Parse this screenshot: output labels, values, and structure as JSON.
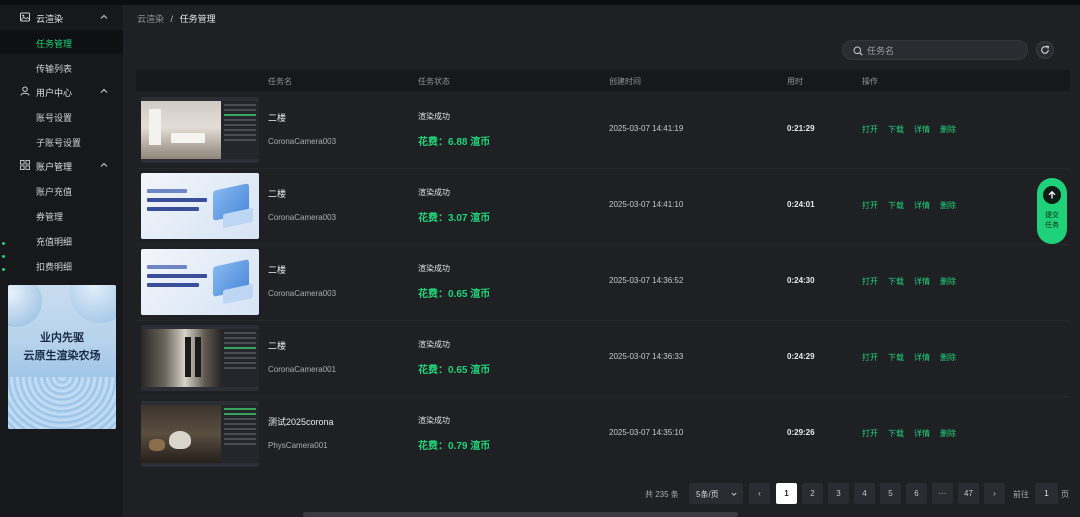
{
  "sidebar": {
    "groups": [
      {
        "label": "云渲染",
        "icon": "image-icon"
      },
      {
        "label": "用户中心",
        "icon": "user-icon"
      },
      {
        "label": "账户管理",
        "icon": "grid-icon"
      }
    ],
    "items": {
      "task_manage": "任务管理",
      "transfer_list": "传输列表",
      "account_settings": "账号设置",
      "sub_account_settings": "子账号设置",
      "account_recharge": "账户充值",
      "voucher_manage": "券管理",
      "recharge_detail": "充值明细",
      "deduct_detail": "扣费明细"
    },
    "promo": {
      "line1": "业内先驱",
      "line2": "云原生渲染农场"
    }
  },
  "breadcrumb": {
    "root": "云渲染",
    "sep": "/",
    "current": "任务管理"
  },
  "search": {
    "placeholder": "任务名"
  },
  "table": {
    "headers": {
      "name": "任务名",
      "status": "任务状态",
      "created": "创建时间",
      "duration": "用时",
      "ops": "操作"
    },
    "actions": {
      "open": "打开",
      "download": "下载",
      "detail": "详情",
      "delete": "删除"
    },
    "rows": [
      {
        "name": "二楼",
        "camera": "CoronaCamera003",
        "status": "渲染成功",
        "cost": "花费：6.88 渲币",
        "created": "2025-03-07 14:41:19",
        "duration": "0:21:29"
      },
      {
        "name": "二楼",
        "camera": "CoronaCamera003",
        "status": "渲染成功",
        "cost": "花费：3.07 渲币",
        "created": "2025-03-07 14:41:10",
        "duration": "0:24:01"
      },
      {
        "name": "二楼",
        "camera": "CoronaCamera003",
        "status": "渲染成功",
        "cost": "花费：0.65 渲币",
        "created": "2025-03-07 14:36:52",
        "duration": "0:24:30"
      },
      {
        "name": "二楼",
        "camera": "CoronaCamera001",
        "status": "渲染成功",
        "cost": "花费：0.65 渲币",
        "created": "2025-03-07 14:36:33",
        "duration": "0:24:29"
      },
      {
        "name": "测试2025corona",
        "camera": "PhysCamera001",
        "status": "渲染成功",
        "cost": "花费：0.79 渲币",
        "created": "2025-03-07 14:35:10",
        "duration": "0:29:26"
      }
    ]
  },
  "float_button": {
    "line1": "提交",
    "line2": "任务"
  },
  "pagination": {
    "total": "共 235 条",
    "page_size": "5条/页",
    "pages": [
      "1",
      "2",
      "3",
      "4",
      "5",
      "6",
      "···",
      "47"
    ],
    "prev": "‹",
    "next": "›",
    "goto_label": "前往",
    "goto_value": "1",
    "goto_suffix": "页"
  }
}
